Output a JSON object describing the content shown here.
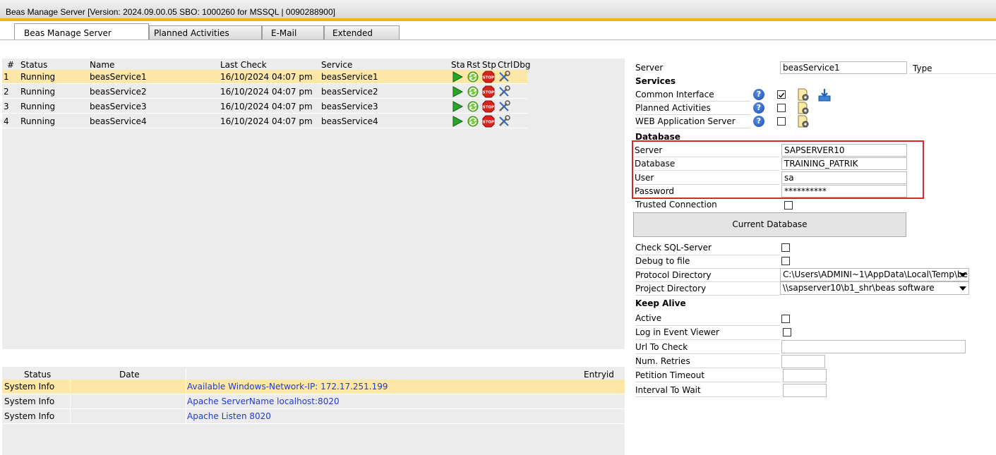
{
  "window": {
    "title": "Beas Manage Server [Version: 2024.09.00.05 SBO: 1000260 for MSSQL | 0090288900]"
  },
  "tabs": [
    {
      "label": "Beas Manage Server"
    },
    {
      "label": "Planned Activities"
    },
    {
      "label": "E-Mail"
    },
    {
      "label": "Extended"
    }
  ],
  "services_grid": {
    "headers": {
      "num": "#",
      "status": "Status",
      "name": "Name",
      "last_check": "Last Check",
      "service": "Service",
      "sta": "Sta",
      "rst": "Rst",
      "stp": "Stp",
      "ctrl": "Ctrl",
      "dbg": "Dbg"
    },
    "rows": [
      {
        "num": "1",
        "status": "Running",
        "name": "beasService1",
        "last_check": "16/10/2024 04:07 pm",
        "service": "beasService1"
      },
      {
        "num": "2",
        "status": "Running",
        "name": "beasService2",
        "last_check": "16/10/2024 04:07 pm",
        "service": "beasService2"
      },
      {
        "num": "3",
        "status": "Running",
        "name": "beasService3",
        "last_check": "16/10/2024 04:07 pm",
        "service": "beasService3"
      },
      {
        "num": "4",
        "status": "Running",
        "name": "beasService4",
        "last_check": "16/10/2024 04:07 pm",
        "service": "beasService4"
      }
    ]
  },
  "log_grid": {
    "headers": {
      "status": "Status",
      "date": "Date",
      "entryid": "Entryid"
    },
    "rows": [
      {
        "status": "System Info",
        "date": "",
        "message": "Available Windows-Network-IP: 172.17.251.199"
      },
      {
        "status": "System Info",
        "date": "",
        "message": "Apache ServerName localhost:8020"
      },
      {
        "status": "System Info",
        "date": "",
        "message": "Apache Listen 8020"
      }
    ]
  },
  "right": {
    "server_label": "Server",
    "server_value": "beasService1",
    "type_label": "Type",
    "services_title": "Services",
    "services": [
      {
        "label": "Common Interface",
        "checked": true
      },
      {
        "label": "Planned Activities",
        "checked": false
      },
      {
        "label": "WEB Application Server",
        "checked": false
      }
    ],
    "database_title": "Database",
    "db_server_label": "Server",
    "db_server_value": "SAPSERVER10",
    "db_database_label": "Database",
    "db_database_value": "TRAINING_PATRIK",
    "db_user_label": "User",
    "db_user_value": "sa",
    "db_password_label": "Password",
    "db_password_value": "**********",
    "trusted_label": "Trusted Connection",
    "current_db_button": "Current Database",
    "check_sql_label": "Check SQL-Server",
    "debug_file_label": "Debug to file",
    "protocol_dir_label": "Protocol Directory",
    "protocol_dir_value": "C:\\Users\\ADMINI~1\\AppData\\Local\\Temp\\be",
    "project_dir_label": "Project Directory",
    "project_dir_value": "\\\\sapserver10\\b1_shr\\beas software",
    "keepalive_title": "Keep Alive",
    "active_label": "Active",
    "event_viewer_label": "Log in Event Viewer",
    "url_check_label": "Url To Check",
    "num_retries_label": "Num. Retries",
    "petition_timeout_label": "Petition Timeout",
    "interval_wait_label": "Interval To Wait",
    "help_glyph": "?"
  },
  "icons": {
    "start": "play-icon",
    "restart": "restart-icon",
    "stop": "stop-icon",
    "ctrl": "tools-icon",
    "gear": "gear-document-icon",
    "download": "download-icon"
  },
  "colors": {
    "accent": "#f0b51a",
    "selected_row": "#fde7a6",
    "highlight_box": "#d42a2a",
    "link": "#1f3bd1"
  }
}
